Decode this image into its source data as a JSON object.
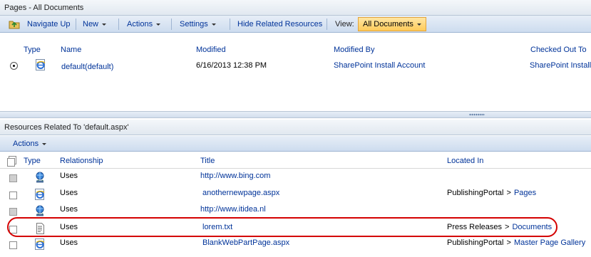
{
  "top_pane": {
    "title": "Pages - All Documents",
    "toolbar": {
      "navigate_up": "Navigate Up",
      "new": "New",
      "actions": "Actions",
      "settings": "Settings",
      "hide_related": "Hide Related Resources",
      "view_label": "View:",
      "view_value": "All Documents"
    },
    "columns": {
      "type": "Type",
      "name": "Name",
      "modified": "Modified",
      "modified_by": "Modified By",
      "checked_out_to": "Checked Out To"
    },
    "rows": [
      {
        "name": "default(default)",
        "modified": "6/16/2013 12:38 PM",
        "modified_by": "SharePoint Install Account",
        "checked_out_to": "SharePoint Install"
      }
    ]
  },
  "related_pane": {
    "title": "Resources Related To 'default.aspx'",
    "actions": "Actions",
    "columns": {
      "type": "Type",
      "relationship": "Relationship",
      "title": "Title",
      "located_in": "Located In"
    },
    "rows": [
      {
        "type_icon": "web-link-icon",
        "relationship": "Uses",
        "title": "http://www.bing.com",
        "location_site": "",
        "location_sep": "",
        "location_list": "",
        "checkbox_disabled": true
      },
      {
        "type_icon": "ie-page-icon",
        "relationship": "Uses",
        "title": "anothernewpage.aspx",
        "location_site": "PublishingPortal",
        "location_sep": ">",
        "location_list": "Pages",
        "checkbox_disabled": false
      },
      {
        "type_icon": "web-link-icon",
        "relationship": "Uses",
        "title": "http://www.itidea.nl",
        "location_site": "",
        "location_sep": "",
        "location_list": "",
        "checkbox_disabled": true
      },
      {
        "type_icon": "text-file-icon",
        "relationship": "Uses",
        "title": "lorem.txt",
        "location_site": "Press Releases",
        "location_sep": ">",
        "location_list": "Documents",
        "checkbox_disabled": false
      },
      {
        "type_icon": "ie-page-icon",
        "relationship": "Uses",
        "title": "BlankWebPartPage.aspx",
        "location_site": "PublishingPortal",
        "location_sep": ">",
        "location_list": "Master Page Gallery",
        "checkbox_disabled": false
      }
    ]
  },
  "colors": {
    "link": "#003399",
    "highlight": "#d40000",
    "view_select": "#ffcb5a"
  }
}
